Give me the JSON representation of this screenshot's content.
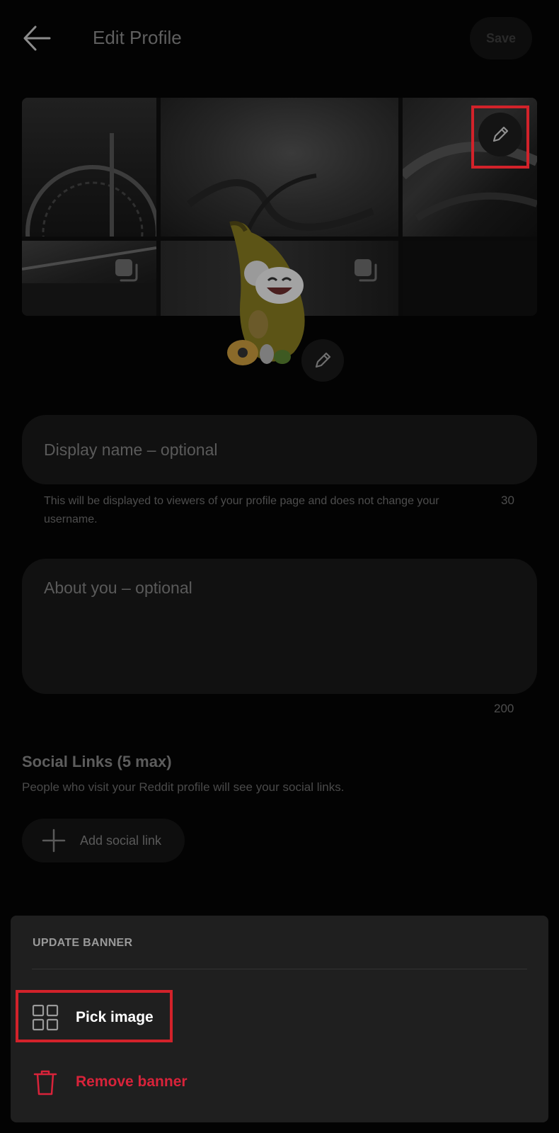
{
  "header": {
    "title": "Edit Profile",
    "save_label": "Save"
  },
  "form": {
    "display_name_placeholder": "Display name – optional",
    "display_name_helper": "This will be displayed to viewers of your profile page and does not change your username.",
    "display_name_counter": "30",
    "about_placeholder": "About you – optional",
    "about_counter": "200"
  },
  "social": {
    "title": "Social Links (5 max)",
    "description": "People who visit your Reddit profile will see your social links.",
    "add_label": "Add social link"
  },
  "sheet": {
    "title": "UPDATE BANNER",
    "items": [
      {
        "label": "Pick image",
        "icon": "grid-icon"
      },
      {
        "label": "Remove banner",
        "icon": "trash-icon"
      }
    ]
  },
  "colors": {
    "highlight": "#d2222a",
    "danger": "#d8233a",
    "background": "#030303",
    "sheet": "#1f1f1f"
  }
}
